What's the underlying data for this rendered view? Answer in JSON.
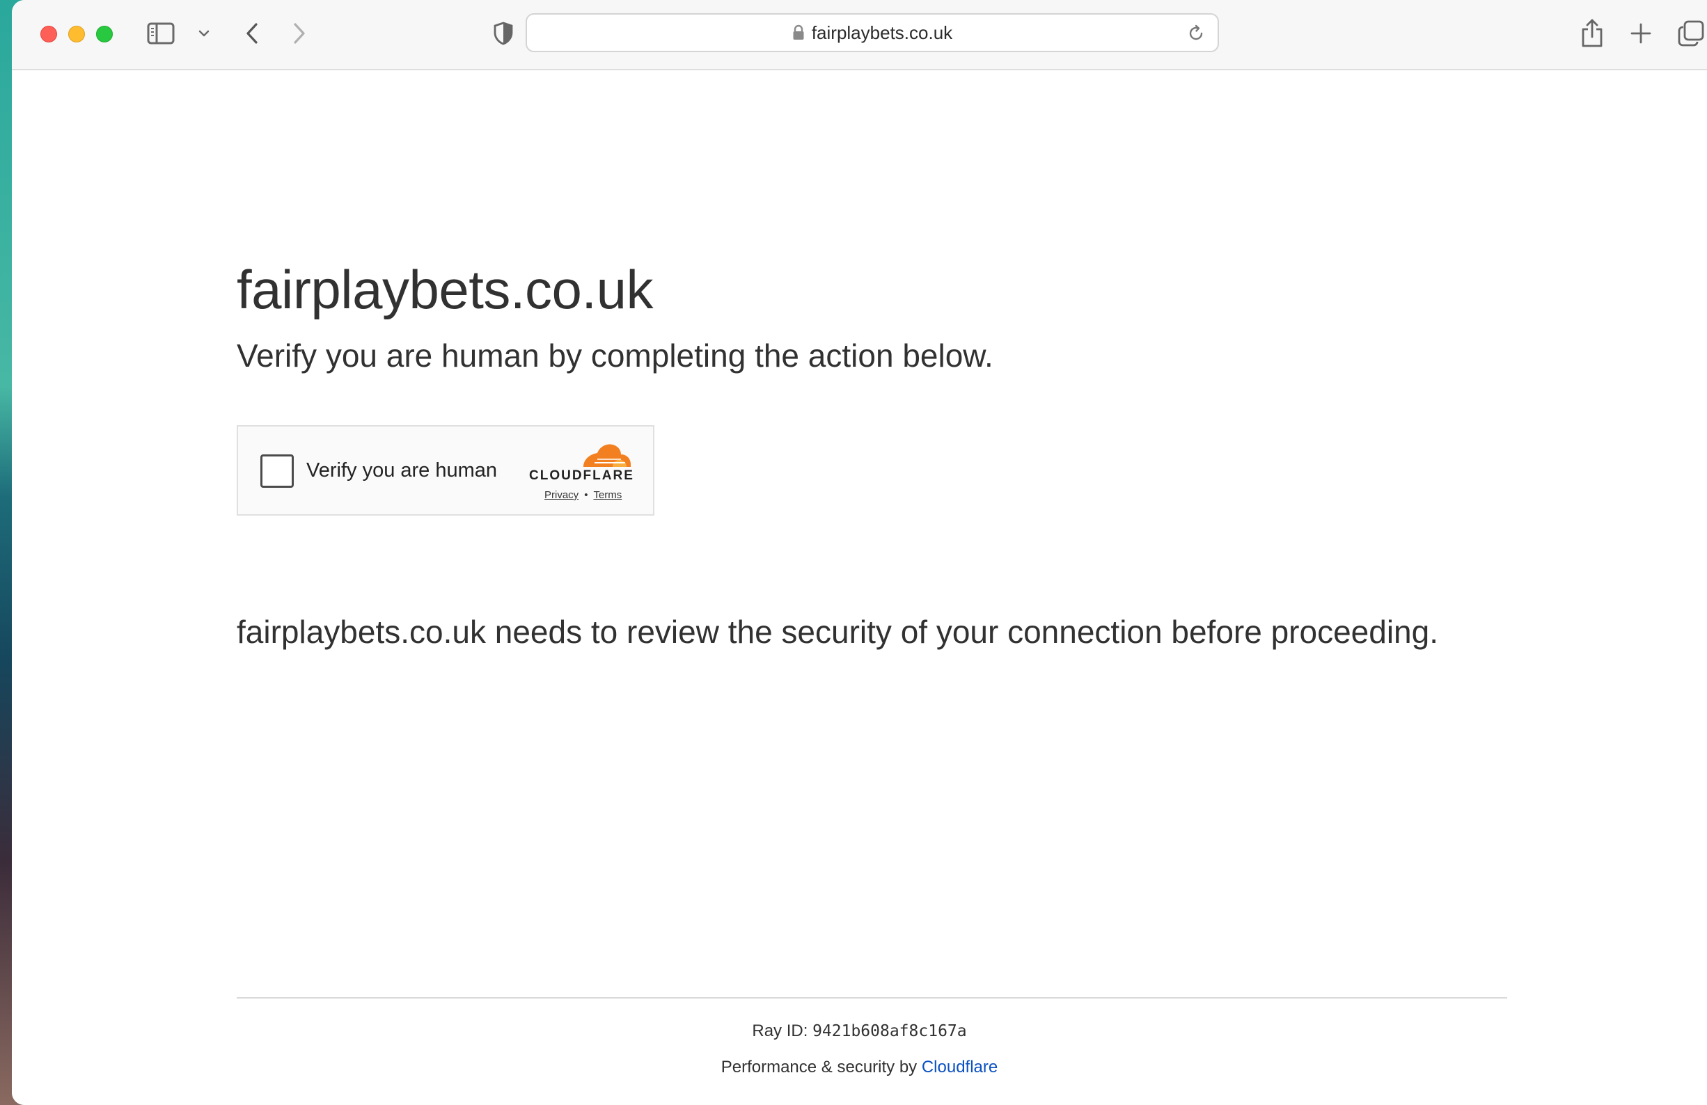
{
  "browser": {
    "url": "fairplaybets.co.uk",
    "icons": {
      "sidebar": "sidebar-icon",
      "sidebar_menu": "chevron-down-icon",
      "back": "chevron-left-icon",
      "forward": "chevron-right-icon",
      "privacy": "shield-icon",
      "lock": "lock-icon",
      "reload": "reload-icon",
      "share": "share-icon",
      "new_tab": "plus-icon",
      "tab_overview": "tabs-icon"
    }
  },
  "page": {
    "site_title": "fairplaybets.co.uk",
    "subtitle": "Verify you are human by completing the action below.",
    "challenge": {
      "checkbox_label": "Verify you are human",
      "brand": "CLOUDFLARE",
      "privacy_link": "Privacy",
      "separator": "•",
      "terms_link": "Terms",
      "checked": false,
      "brand_color": "#f38020"
    },
    "notice": "fairplaybets.co.uk needs to review the security of your connection before proceeding.",
    "footer": {
      "ray_label": "Ray ID:",
      "ray_id": "9421b608af8c167a",
      "perf_text": "Performance & security by",
      "perf_link": "Cloudflare",
      "link_color": "#0b51c1"
    }
  }
}
